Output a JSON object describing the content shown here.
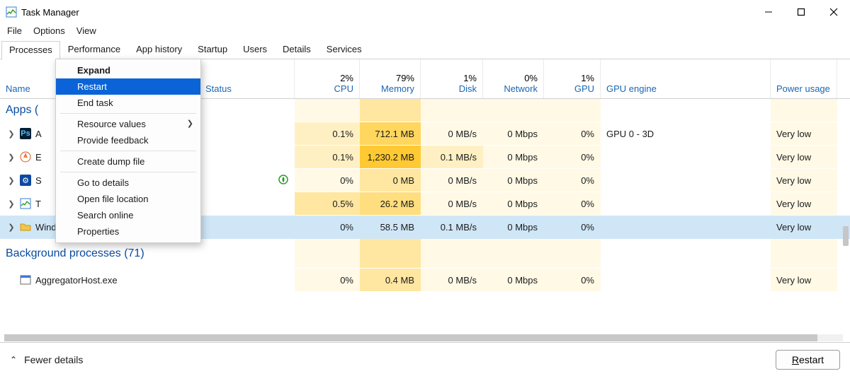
{
  "window": {
    "title": "Task Manager"
  },
  "menubar": [
    "File",
    "Options",
    "View"
  ],
  "tabs": [
    "Processes",
    "Performance",
    "App history",
    "Startup",
    "Users",
    "Details",
    "Services"
  ],
  "active_tab_index": 0,
  "columns": {
    "name": "Name",
    "status": "Status",
    "cpu": {
      "top": "2%",
      "bottom": "CPU"
    },
    "memory": {
      "top": "79%",
      "bottom": "Memory"
    },
    "disk": {
      "top": "1%",
      "bottom": "Disk"
    },
    "network": {
      "top": "0%",
      "bottom": "Network"
    },
    "gpu": {
      "top": "1%",
      "bottom": "GPU"
    },
    "gpu_engine": "GPU engine",
    "power": "Power usage"
  },
  "sections": {
    "apps": "Apps (",
    "background": "Background processes (71)"
  },
  "rows": [
    {
      "icon": "ps",
      "name": "A",
      "cpu": "0.1%",
      "mem": "712.1 MB",
      "disk": "0 MB/s",
      "net": "0 Mbps",
      "gpu": "0%",
      "eng": "GPU 0 - 3D",
      "pwr": "Very low"
    },
    {
      "icon": "brv",
      "name": "E",
      "cpu": "0.1%",
      "mem": "1,230.2 MB",
      "disk": "0.1 MB/s",
      "net": "0 Mbps",
      "gpu": "0%",
      "eng": "",
      "pwr": "Very low"
    },
    {
      "icon": "gear",
      "name": "S",
      "cpu": "0%",
      "mem": "0 MB",
      "disk": "0 MB/s",
      "net": "0 Mbps",
      "gpu": "0%",
      "eng": "",
      "pwr": "Very low",
      "leaf": true
    },
    {
      "icon": "tm",
      "name": "T",
      "cpu": "0.5%",
      "mem": "26.2 MB",
      "disk": "0 MB/s",
      "net": "0 Mbps",
      "gpu": "0%",
      "eng": "",
      "pwr": "Very low"
    },
    {
      "icon": "fold",
      "name": "Windows Explorer",
      "cpu": "0%",
      "mem": "58.5 MB",
      "disk": "0.1 MB/s",
      "net": "0 Mbps",
      "gpu": "0%",
      "eng": "",
      "pwr": "Very low",
      "selected": true
    }
  ],
  "bg_rows": [
    {
      "icon": "exe",
      "name": "AggregatorHost.exe",
      "cpu": "0%",
      "mem": "0.4 MB",
      "disk": "0 MB/s",
      "net": "0 Mbps",
      "gpu": "0%",
      "eng": "",
      "pwr": "Very low"
    }
  ],
  "context_menu": {
    "items": [
      {
        "label": "Expand",
        "bold": true
      },
      {
        "label": "Restart",
        "highlight": true
      },
      {
        "label": "End task"
      },
      {
        "sep": true
      },
      {
        "label": "Resource values",
        "submenu": true
      },
      {
        "label": "Provide feedback"
      },
      {
        "sep": true
      },
      {
        "label": "Create dump file"
      },
      {
        "sep": true
      },
      {
        "label": "Go to details"
      },
      {
        "label": "Open file location"
      },
      {
        "label": "Search online"
      },
      {
        "label": "Properties"
      }
    ]
  },
  "footer": {
    "fewer": "Fewer details",
    "restart": "Restart"
  }
}
